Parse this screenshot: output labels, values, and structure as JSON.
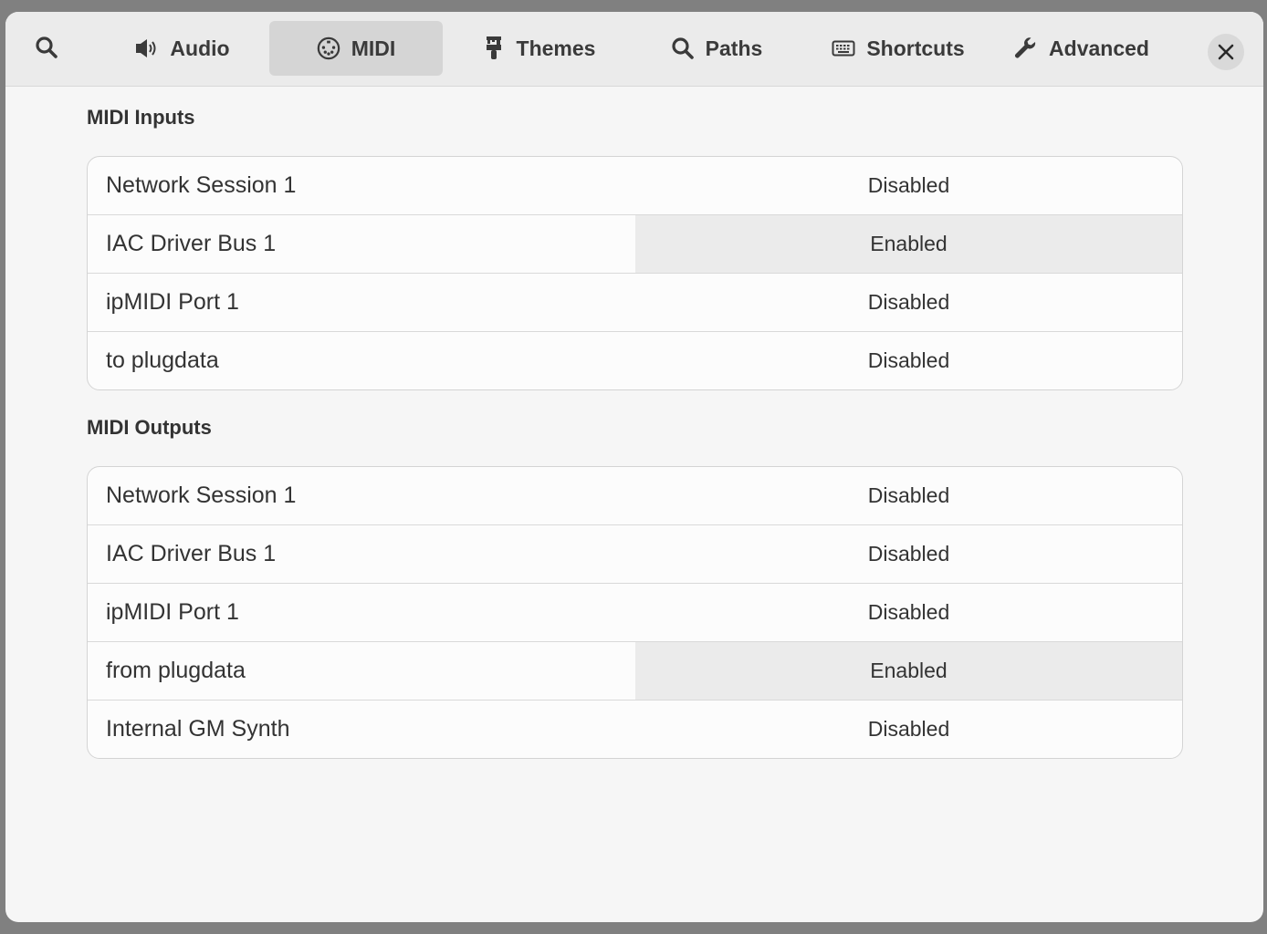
{
  "toolbar": {
    "search_icon": "search-icon",
    "tabs": [
      {
        "label": "Audio",
        "icon": "speaker-icon"
      },
      {
        "label": "MIDI",
        "icon": "midi-port-icon",
        "active": true
      },
      {
        "label": "Themes",
        "icon": "paintbrush-icon"
      },
      {
        "label": "Paths",
        "icon": "search-icon"
      },
      {
        "label": "Shortcuts",
        "icon": "keyboard-icon"
      },
      {
        "label": "Advanced",
        "icon": "wrench-icon"
      }
    ],
    "close_icon": "close-icon"
  },
  "midi_inputs": {
    "title": "MIDI Inputs",
    "rows": [
      {
        "name": "Network Session 1",
        "status": "Disabled"
      },
      {
        "name": "IAC Driver Bus 1",
        "status": "Enabled"
      },
      {
        "name": "ipMIDI Port 1",
        "status": "Disabled"
      },
      {
        "name": "to plugdata",
        "status": "Disabled"
      }
    ]
  },
  "midi_outputs": {
    "title": "MIDI Outputs",
    "rows": [
      {
        "name": "Network Session 1",
        "status": "Disabled"
      },
      {
        "name": "IAC Driver Bus 1",
        "status": "Disabled"
      },
      {
        "name": "ipMIDI Port 1",
        "status": "Disabled"
      },
      {
        "name": "from plugdata",
        "status": "Enabled"
      },
      {
        "name": "Internal GM Synth",
        "status": "Disabled"
      }
    ]
  },
  "colors": {
    "window_bg": "#f6f6f6",
    "toolbar_bg": "#ebebeb",
    "active_tab_bg": "#d5d5d5",
    "enabled_bg": "#ebebeb",
    "text": "#333333"
  }
}
